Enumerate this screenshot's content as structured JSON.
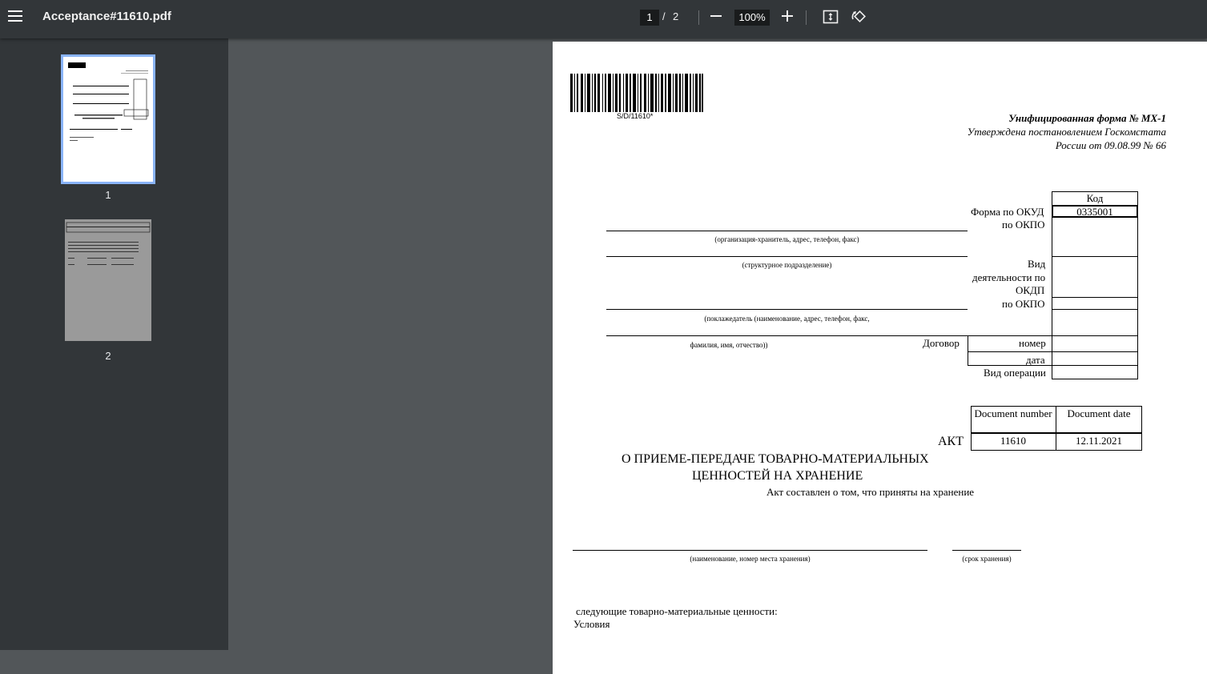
{
  "toolbar": {
    "file_name": "Acceptance#11610.pdf",
    "current_page": "1",
    "separator": "/",
    "total_pages": "2",
    "zoom": "100%"
  },
  "sidebar": {
    "thumbnails": [
      {
        "label": "1",
        "selected": true
      },
      {
        "label": "2",
        "selected": false
      }
    ]
  },
  "document": {
    "barcode_text": "S/D/11610*",
    "header": {
      "line1": "Унифицированная форма № МХ-1",
      "line2": "Утверждена постановлением Госкомстата",
      "line3": "России от 09.08.99 № 66"
    },
    "code_table": {
      "header": "Код",
      "okud_label": "Форма по ОКУД",
      "okud_value": "0335001",
      "okpo_label": "по ОКПО",
      "activity_label_1": "Вид",
      "activity_label_2": "деятельности по",
      "activity_label_3": "ОКДП",
      "okpo2_label": "по ОКПО",
      "contract_label": "Договор",
      "number_label": "номер",
      "date_label": "дата",
      "operation_label": "Вид операции"
    },
    "captions": {
      "org": "(организация-хранитель, адрес, телефон, факс)",
      "dept": "(структурное подразделение)",
      "depositor": "(поклажедатель (наименование, адрес, телефон, факс,",
      "depositor2": "фамилия, имя, отчество))",
      "place": "(наименование, номер места хранения)",
      "term": "(срок хранения)"
    },
    "doc_table": {
      "number_header": "Document number",
      "date_header": "Document date",
      "number_value": "11610",
      "date_value": "12.11.2021"
    },
    "act_title": "АКТ",
    "act_subtitle_1": "О ПРИЕМЕ-ПЕРЕДАЧЕ ТОВАРНО-МАТЕРИАЛЬНЫХ",
    "act_subtitle_2": "ЦЕННОСТЕЙ НА ХРАНЕНИЕ",
    "act_note": "Акт составлен о том, что приняты на хранение",
    "following_text": "следующие товарно-материальные ценности:",
    "conditions": "Условия"
  },
  "colors": {
    "toolbar_bg": "#323639",
    "viewer_bg": "#525659",
    "thumb_selected_border": "#8ab4f8"
  }
}
